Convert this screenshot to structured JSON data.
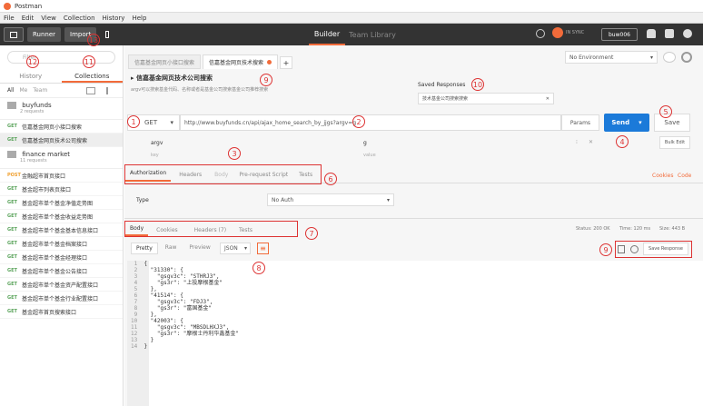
{
  "app": {
    "title": "Postman"
  },
  "menu": [
    "File",
    "Edit",
    "View",
    "Collection",
    "History",
    "Help"
  ],
  "toolbar": {
    "runner": "Runner",
    "import": "Import",
    "builder": "Builder",
    "team_library": "Team Library",
    "sync": "IN SYNC",
    "user": "buw006"
  },
  "sidebar": {
    "search_placeholder": "Filter",
    "tabs": [
      "History",
      "Collections"
    ],
    "filters": [
      "All",
      "Me",
      "Team"
    ],
    "collections": [
      {
        "name": "buyfunds",
        "count": "2 requests"
      },
      {
        "name": "finance market",
        "count": "11 requests"
      }
    ],
    "requests_buyfunds": [
      {
        "method": "GET",
        "name": "信嘉基金网页小接口搜索"
      },
      {
        "method": "GET",
        "name": "信嘉基金网页技术公司搜索"
      }
    ],
    "requests_finance": [
      {
        "method": "POST",
        "name": "金融超市首页接口"
      },
      {
        "method": "GET",
        "name": "基金超市列表页接口"
      },
      {
        "method": "GET",
        "name": "基金超市单个基金净值走势图"
      },
      {
        "method": "GET",
        "name": "基金超市单个基金收益走势图"
      },
      {
        "method": "GET",
        "name": "基金超市单个基金基本信息接口"
      },
      {
        "method": "GET",
        "name": "基金超市单个基金档案接口"
      },
      {
        "method": "GET",
        "name": "基金超市单个基金经理接口"
      },
      {
        "method": "GET",
        "name": "基金超市单个基金公告接口"
      },
      {
        "method": "GET",
        "name": "基金超市单个基金资产配置接口"
      },
      {
        "method": "GET",
        "name": "基金超市单个基金行业配置接口"
      },
      {
        "method": "GET",
        "name": "基金超市首页搜索接口"
      }
    ]
  },
  "tabs": [
    "信嘉基金网页小接口搜索",
    "信嘉基金网页技术搜索"
  ],
  "environment": "No Environment",
  "request": {
    "title": "信嘉基金网页技术公司搜索",
    "description": "argv可以搜索基金代码、名称或者是基金公司搜索基金公司推荐搜索",
    "method": "GET",
    "url": "http://www.buyfunds.cn/api/ajax_home_search_by_jjgs?argv=g",
    "params": "Params",
    "send": "Send",
    "save": "Save",
    "param_key": "argv",
    "param_value": "g",
    "key_ph": "key",
    "value_ph": "value",
    "bulk_edit": "Bulk Edit",
    "tabs": [
      "Authorization",
      "Headers",
      "Body",
      "Pre-request Script",
      "Tests"
    ],
    "cookies": "Cookies",
    "code": "Code",
    "type_label": "Type",
    "auth_type": "No Auth"
  },
  "saved": {
    "label": "Saved Responses",
    "value": "技术基金公司搜索搜索"
  },
  "response": {
    "tabs": [
      "Body",
      "Cookies",
      "Headers (7)",
      "Tests"
    ],
    "status": "Status: 200 OK",
    "time": "Time: 120 ms",
    "size": "Size: 443 B",
    "views": [
      "Pretty",
      "Raw",
      "Preview"
    ],
    "format": "JSON",
    "save_response": "Save Response",
    "lines": [
      "{",
      "  \"31330\": {",
      "    \"gsgv3c\": \"STHRJ3\",",
      "    \"gs3r\": \"上投摩根基金\"",
      "  },",
      "  \"41514\": {",
      "    \"gsgv3c\": \"FDJ3\",",
      "    \"gs3r\": \"富国基金\"",
      "  },",
      "  \"42003\": {",
      "    \"gsgv3c\": \"MBSDLHXJ3\",",
      "    \"gs3r\": \"摩根士丹利华鑫基金\"",
      "  }",
      "}"
    ]
  },
  "annotations": [
    "1",
    "2",
    "3",
    "4",
    "5",
    "6",
    "7",
    "8",
    "9",
    "9",
    "10",
    "11",
    "12",
    "13"
  ]
}
